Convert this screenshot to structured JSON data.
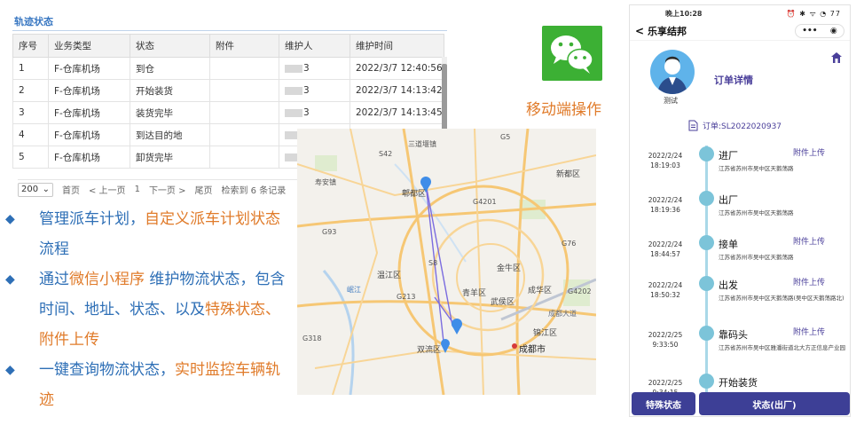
{
  "track_panel": {
    "title": "轨迹状态",
    "columns": [
      "序号",
      "业务类型",
      "状态",
      "附件",
      "维护人",
      "维护时间"
    ],
    "rows": [
      [
        "1",
        "F-仓库机场",
        "到仓",
        "",
        "3",
        "2022/3/7 12:40:56"
      ],
      [
        "2",
        "F-仓库机场",
        "开始装货",
        "",
        "3",
        "2022/3/7 14:13:42"
      ],
      [
        "3",
        "F-仓库机场",
        "装货完毕",
        "",
        "3",
        "2022/3/7 14:13:45"
      ],
      [
        "4",
        "F-仓库机场",
        "到达目的地",
        "",
        "",
        ""
      ],
      [
        "5",
        "F-仓库机场",
        "卸货完毕",
        "",
        "",
        ""
      ]
    ],
    "pager": {
      "page_size": "200",
      "first": "首页",
      "prev": "< 上一页",
      "page": "1",
      "next": "下一页 >",
      "last": "尾页",
      "total": "检索到 6 条记录"
    }
  },
  "mobile_op_label": "移动端操作",
  "bullets": [
    [
      {
        "text": "管理派车计划，",
        "style": "blue"
      },
      {
        "text": "自定义派车计划状态",
        "style": "orange"
      },
      {
        "text": "流程",
        "style": "blue"
      }
    ],
    [
      {
        "text": "通过",
        "style": "blue"
      },
      {
        "text": "微信小程序",
        "style": "orange"
      },
      {
        "text": " 维护物流状态，包含时间、地址、状态、以及",
        "style": "blue"
      },
      {
        "text": "特殊状态、附件上传",
        "style": "orange"
      }
    ],
    [
      {
        "text": "一键查询物流状态，",
        "style": "blue"
      },
      {
        "text": "实时监控车辆轨迹",
        "style": "orange"
      }
    ]
  ],
  "map": {
    "labels": {
      "l1": "三道堰镇",
      "l2": "新都区",
      "l3": "寿安镇",
      "l4": "郫都区",
      "l5": "金牛区",
      "l6": "温江区",
      "l7": "成华区",
      "l8": "青羊区",
      "l9": "武侯区",
      "l10": "锦江区",
      "l11": "双流区",
      "l12": "成都市",
      "l13": "岷江",
      "l14": "G5",
      "l15": "G4201",
      "l16": "S8",
      "l17": "G76",
      "l18": "G93",
      "l19": "G4202",
      "l20": "G318",
      "l21": "成都大道",
      "l22": "S42",
      "l23": "G213"
    }
  },
  "phone": {
    "status_time": "晚上10:28",
    "status_icons": "⏰ ✱ ᯤ ◔ 77",
    "nav_title": "乐享结邦",
    "nav_back": "<",
    "capsule_more": "•••",
    "capsule_close": "◉",
    "avatar_name": "测试",
    "order_detail_title": "订单详情",
    "order_no": "订单:SL2022020937",
    "timeline": [
      {
        "date": "2022/2/24",
        "time": "18:19:03",
        "status": "进厂",
        "upload": "附件上传",
        "address": "江苏省苏州市吴中区天鹅荡路"
      },
      {
        "date": "2022/2/24",
        "time": "18:19:36",
        "status": "出厂",
        "upload": "",
        "address": "江苏省苏州市吴中区天鹅荡路"
      },
      {
        "date": "2022/2/24",
        "time": "18:44:57",
        "status": "接单",
        "upload": "附件上传",
        "address": "江苏省苏州市吴中区天鹅荡路"
      },
      {
        "date": "2022/2/24",
        "time": "18:50:32",
        "status": "出发",
        "upload": "附件上传",
        "address": "江苏省苏州市吴中区天鹅荡路(吴中区天鹅荡路北)"
      },
      {
        "date": "2022/2/25",
        "time": "9:33:50",
        "status": "靠码头",
        "upload": "附件上传",
        "address": "江苏省苏州市吴中区雅潘街道北大方正信息产业园"
      },
      {
        "date": "2022/2/25",
        "time": "9:34:15",
        "status": "开始装货",
        "upload": "",
        "address": ""
      }
    ],
    "btn_special": "特殊状态",
    "btn_status": "状态(出厂)"
  },
  "colors": {
    "accent_blue": "#2e6fb6",
    "accent_orange": "#e07b2a",
    "wechat_green": "#3cb034",
    "phone_button": "#3d3f96",
    "timeline_dot": "#7cc4d9"
  }
}
